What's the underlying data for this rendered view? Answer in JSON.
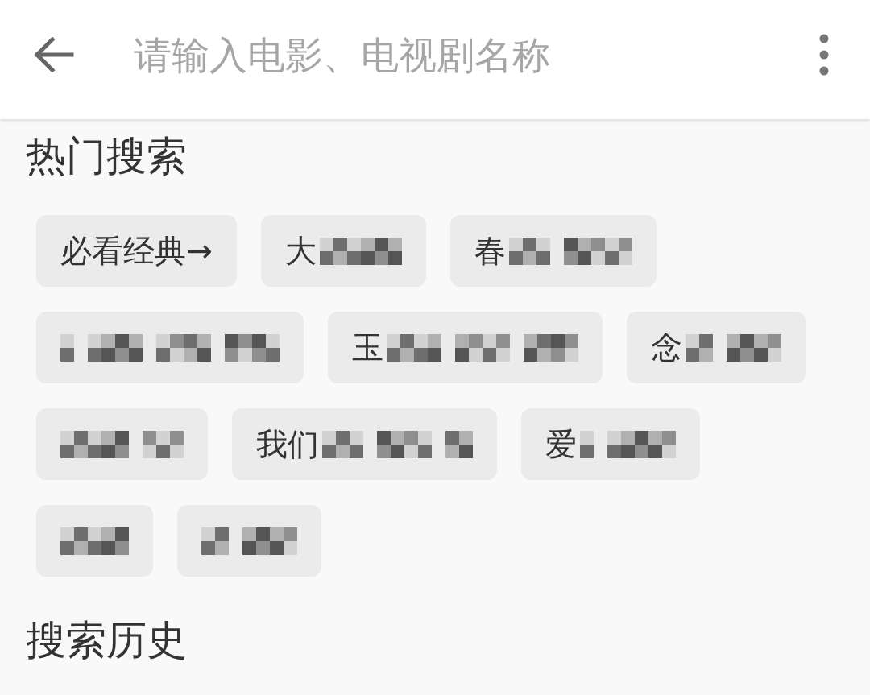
{
  "top_bar": {
    "search": {
      "placeholder": "请输入电影、电视剧名称"
    }
  },
  "hot_searches": {
    "title": "热门搜索",
    "chips": [
      {
        "label": "必看经典→",
        "censored": false
      },
      {
        "label": "大",
        "censored": true
      },
      {
        "label": "春",
        "censored": true
      },
      {
        "censored": true
      },
      {
        "label": "玉",
        "censored": true
      },
      {
        "label": "念",
        "censored": true
      },
      {
        "censored": true
      },
      {
        "label": "我们",
        "censored": true
      },
      {
        "label": "爱",
        "censored": true
      },
      {
        "censored": true
      },
      {
        "censored": true
      }
    ]
  },
  "search_history": {
    "title": "搜索历史"
  }
}
